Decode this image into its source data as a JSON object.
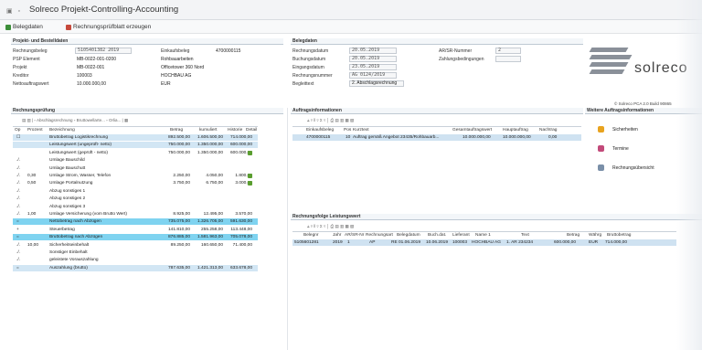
{
  "window": {
    "title": "Solreco Projekt-Controlling-Accounting",
    "title_icons": "▣ ▫"
  },
  "toolbar": {
    "button_1": "Belegdaten",
    "button_2": "Rechnungsprüfblatt erzeugen"
  },
  "projekt_section": {
    "heading": "Projekt- und Bestelldaten",
    "left": [
      {
        "label": "Rechnungsbeleg",
        "value": "5105401382 2019",
        "boxed": true
      },
      {
        "label": "PSP Element",
        "value": "MB-0022-001-0200"
      },
      {
        "label": "Projekt",
        "value": "MB-0022-001"
      },
      {
        "label": "Kreditor",
        "value": "100003"
      },
      {
        "label": "Nettoauftragswert",
        "value": "10.000.000,00"
      }
    ],
    "mid": [
      {
        "label": "Einkaufsbeleg",
        "value": "4700000115"
      },
      {
        "label": "",
        "value": "Rohbauarbeiten"
      },
      {
        "label": "",
        "value": "Officetower 360 Nord"
      },
      {
        "label": "",
        "value": "HOCHBAU AG"
      },
      {
        "label": "",
        "value": "EUR"
      }
    ]
  },
  "belegdaten": {
    "heading": "Belegdaten",
    "rows": [
      {
        "label": "Rechnungsdatum",
        "value": "20.05.2019"
      },
      {
        "label": "Buchungsdatum",
        "value": "20.05.2019"
      },
      {
        "label": "Eingangsdatum",
        "value": "23.05.2019"
      },
      {
        "label": "Rechnungsnummer",
        "value": "AG 0124/2019"
      },
      {
        "label": "Begleittext",
        "value": "2. Abschlagsrechnung"
      }
    ],
    "right": [
      {
        "label": "AR/SR-Nummer",
        "value": "2"
      },
      {
        "label": "Zahlungsbedingungen",
        "value": ""
      }
    ]
  },
  "logo": {
    "text": "solreco",
    "build": "© Solreco PCA 2.0 Build 90865"
  },
  "rechnungspruefung": {
    "heading": "Rechnungsprüfung",
    "toolbar": "▤ ▥ | ▫ Abschlagsrechnung ▫ Bruttowellarte... ▫ Orlia... | ▦",
    "columns": {
      "op": "Op",
      "prozent": "Prozent",
      "bezeichnung": "Bezeichnung",
      "betrag": "Betrag",
      "kumuliert": "kumuliert",
      "historie": "Historie",
      "detail": "Detail"
    },
    "rows": [
      {
        "op": "☐",
        "prozent": "",
        "bez": "Bruttobetrag Logistikrechnung",
        "betrag": "892.500,00",
        "kum": "1.606.500,00",
        "hist": "714.000,00",
        "flag": false,
        "style": "blue"
      },
      {
        "op": "",
        "prozent": "",
        "bez": "Leistungswert (ungeprüft- netto)",
        "betrag": "750.000,00",
        "kum": "1.350.000,00",
        "hist": "600.000,00",
        "flag": false,
        "style": "blue"
      },
      {
        "op": "",
        "prozent": "",
        "bez": "Leistungswert (geprüft - netto)",
        "betrag": "750.000,00",
        "kum": "1.350.000,00",
        "hist": "600.000,00",
        "flag": true,
        "style": ""
      },
      {
        "op": "./.",
        "prozent": "",
        "bez": "Umlage Bauschild",
        "betrag": "",
        "kum": "",
        "hist": "",
        "flag": false,
        "style": ""
      },
      {
        "op": "./.",
        "prozent": "",
        "bez": "Umlage Bauschutt",
        "betrag": "",
        "kum": "",
        "hist": "",
        "flag": false,
        "style": ""
      },
      {
        "op": "./.",
        "prozent": "0,30",
        "bez": "Umlage Strom, Wasser, Telefon",
        "betrag": "2.250,00",
        "kum": "4.050,00",
        "hist": "1.800,00",
        "flag": true,
        "style": ""
      },
      {
        "op": "./.",
        "prozent": "0,50",
        "bez": "Umlage Portalnutzung",
        "betrag": "3.750,00",
        "kum": "6.750,00",
        "hist": "3.000,00",
        "flag": true,
        "style": ""
      },
      {
        "op": "./.",
        "prozent": "",
        "bez": "Abzug sonstiges 1",
        "betrag": "",
        "kum": "",
        "hist": "",
        "flag": false,
        "style": ""
      },
      {
        "op": "./.",
        "prozent": "",
        "bez": "Abzug sonstiges 2",
        "betrag": "",
        "kum": "",
        "hist": "",
        "flag": false,
        "style": ""
      },
      {
        "op": "./.",
        "prozent": "",
        "bez": "Abzug sonstiges 3",
        "betrag": "",
        "kum": "",
        "hist": "",
        "flag": false,
        "style": ""
      },
      {
        "op": "./.",
        "prozent": "1,00",
        "bez": "Umlage Versicherung (vom Brutto Wert)",
        "betrag": "8.925,00",
        "kum": "12.495,00",
        "hist": "3.570,00",
        "flag": false,
        "style": ""
      },
      {
        "op": "=",
        "prozent": "",
        "bez": "Nettobetrag nach Abzügen",
        "betrag": "735.075,00",
        "kum": "1.326.705,00",
        "hist": "591.630,00",
        "flag": false,
        "style": "cyan"
      },
      {
        "op": "+",
        "prozent": "",
        "bez": "Steuerbetrag",
        "betrag": "141.810,00",
        "kum": "255.258,00",
        "hist": "113.448,00",
        "flag": false,
        "style": ""
      },
      {
        "op": "=",
        "prozent": "",
        "bez": "Bruttobetrag nach Abzügen",
        "betrag": "876.885,00",
        "kum": "1.581.963,00",
        "hist": "705.078,00",
        "flag": false,
        "style": "cyan"
      },
      {
        "op": "./.",
        "prozent": "10,00",
        "bez": "Sicherheitseinbehalt",
        "betrag": "89.250,00",
        "kum": "160.650,00",
        "hist": "71.400,00",
        "flag": false,
        "style": ""
      },
      {
        "op": "./.",
        "prozent": "",
        "bez": "Sonstiger Einbehalt",
        "betrag": "",
        "kum": "",
        "hist": "",
        "flag": false,
        "style": ""
      },
      {
        "op": "./.",
        "prozent": "",
        "bez": "geleistete Vorauszahlung",
        "betrag": "",
        "kum": "",
        "hist": "",
        "flag": false,
        "style": ""
      },
      {
        "op": "=",
        "prozent": "",
        "bez": "Auszahlung (brutto)",
        "betrag": "787.635,00",
        "kum": "1.421.313,00",
        "hist": "633.678,00",
        "flag": false,
        "style": "blue"
      }
    ]
  },
  "auftragsinfo": {
    "heading": "Auftragsinformationen",
    "toolbar": "⫨ ▿ ‖ ▿ Σ ▿ │ ⎙ ▤ ▥ ▦ ▧",
    "columns": {
      "a": "Einkaufsbeleg",
      "b": "Pos",
      "c": "Kurztext",
      "d": "Gesamtauftragswert",
      "e": "Hauptauftrag",
      "f": "Nachtrag"
    },
    "row": {
      "a": "4700000115",
      "b": "10",
      "c": "Auftrag gemäß Angebot 23435/Rohbauarb...",
      "d": "10.000.000,00",
      "e": "10.000.000,00",
      "f": "0,00"
    }
  },
  "rechnungsfolge": {
    "heading": "Rechnungsfolge Leistungswert",
    "toolbar": "⫨ ▿ ‖ ▿ Σ ▿ │ ⎙ ▤ ▥ ▦ ▧",
    "columns": {
      "a": "Belegnr",
      "b": "Jahr",
      "c": "AR/SR-Nr",
      "d": "Rechnungsart",
      "e": "Belegdatum",
      "f": "Buch.dat.",
      "g": "Lieferant",
      "h": "Name 1",
      "i": "Text",
      "j": "Betrag",
      "k": "Währg",
      "l": "Bruttobetrag"
    },
    "row": {
      "a": "5105601281",
      "b": "2019",
      "c": "1",
      "d": "AP",
      "e": "RE 01.06.2019",
      "f": "10.06.2019",
      "g": "100003",
      "h": "HOCHBAU AG",
      "i": "1. AR 234234",
      "j": "600.000,00",
      "k": "EUR",
      "l": "714.000,00"
    }
  },
  "weitere": {
    "heading": "Weitere Auftragsinformationen",
    "items": [
      {
        "label": "Sicherheiten",
        "icon": "coins-icon",
        "color": "#e8a31f"
      },
      {
        "label": "Termine",
        "icon": "calendar-icon",
        "color": "#c24a7a"
      },
      {
        "label": "Rechnungsübersicht",
        "icon": "document-icon",
        "color": "#7a8fa8"
      }
    ]
  }
}
